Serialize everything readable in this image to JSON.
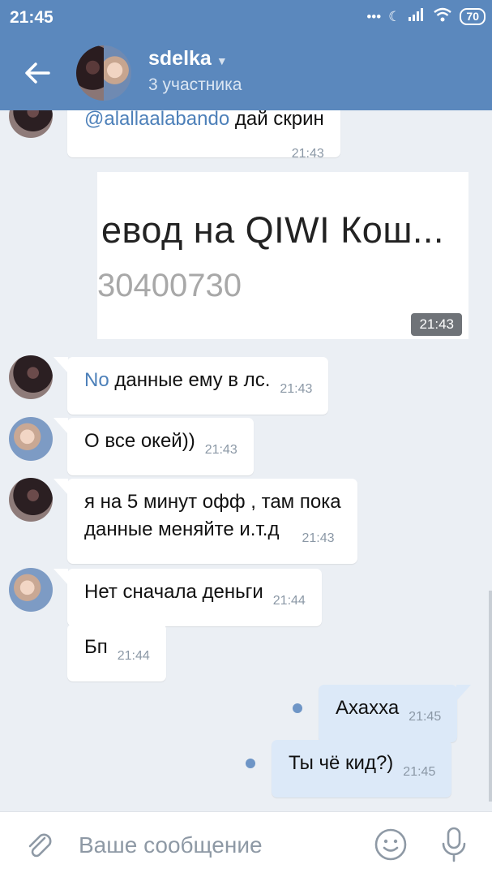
{
  "status_bar": {
    "time": "21:45",
    "battery": "70"
  },
  "header": {
    "title": "sdelka",
    "subtitle": "3 участника"
  },
  "messages": [
    {
      "mention": "@alallaalabando",
      "text": " дай скрин",
      "time": "21:43"
    },
    {
      "image_line1": "евод на QIWI Кош...",
      "image_line2": "30400730",
      "time": "21:43"
    },
    {
      "mention": "No",
      "text": " данные ему в лс.",
      "time": "21:43"
    },
    {
      "text": "О все окей))",
      "time": "21:43"
    },
    {
      "text_line1": "я на 5 минут офф , там пока",
      "text_line2": "данные меняйте и.т.д",
      "time": "21:43"
    },
    {
      "text": "Нет сначала деньги",
      "time": "21:44"
    },
    {
      "text": "Бп",
      "time": "21:44"
    },
    {
      "text": "Ахахха",
      "time": "21:45"
    },
    {
      "text": "Ты чё кид?)",
      "time": "21:45"
    }
  ],
  "composer": {
    "placeholder": "Ваше сообщение"
  },
  "colors": {
    "header": "#5b88bd",
    "incoming": "#ffffff",
    "outgoing": "#dce9f8",
    "background": "#ebeff4",
    "unread_dot": "#6e95c6"
  }
}
